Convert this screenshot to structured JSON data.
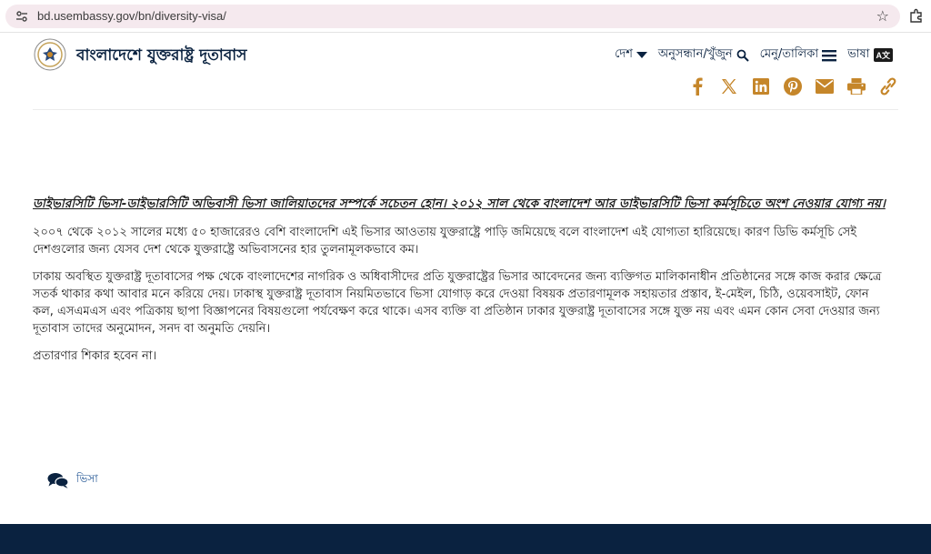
{
  "browser": {
    "url": "bd.usembassy.gov/bn/diversity-visa/"
  },
  "header": {
    "title": "বাংলাদেশে যুক্তরাষ্ট্র দূতাবাস",
    "nav": {
      "country": "দেশ",
      "search": "অনুসন্ধান/খুঁজুন",
      "menu": "মেনু/তালিকা",
      "language": "ভাষা",
      "language_badge": "A文"
    },
    "share_icons": [
      "facebook-icon",
      "x-icon",
      "linkedin-icon",
      "pinterest-icon",
      "email-icon",
      "print-icon",
      "link-icon"
    ],
    "accent_color": "#c5862a",
    "navy_color": "#0a2240"
  },
  "article": {
    "headline": "ডাইভারসিটি ভিসা-ডাইভারসিটি অভিবাসী ভিসা জালিয়াতদের সম্পর্কে সচেতন হোন। ২০১২ সাল থেকে বাংলাদেশ আর ডাইভারসিটি ভিসা কর্মসূচিতে অংশ নেওয়ার যোগ্য নয়।",
    "para1": "২০০৭ থেকে ২০১২ সালের মধ্যে ৫০ হাজারেরও বেশি বাংলাদেশি এই ভিসার আওতায় যুক্তরাষ্ট্রে পাড়ি জমিয়েছে বলে বাংলাদেশ এই যোগ্যতা হারিয়েছে। কারণ ডিভি কর্মসূচি সেই দেশগুলোর জন্য যেসব দেশ থেকে যুক্তরাষ্ট্রে অভিবাসনের হার তুলনামূলকভাবে কম।",
    "para2": "ঢাকায় অবস্থিত যুক্তরাষ্ট্র দূতাবাসের পক্ষ থেকে বাংলাদেশের নাগরিক ও অধিবাসীদের প্রতি যুক্তরাষ্ট্রের ভিসার আবেদনের জন্য ব্যক্তিগত মালিকানাধীন প্রতিষ্ঠানের সঙ্গে কাজ করার ক্ষেত্রে সতর্ক থাকার কথা আবার মনে করিয়ে দেয়। ঢাকাস্থ যুক্তরাষ্ট্র দূতাবাস নিয়মিতভাবে ভিসা যোগাড় করে দেওয়া বিষয়ক প্রতারণামূলক সহায়তার প্রস্তাব, ই-মেইল, চিঠি, ওয়েবসাইট, ফোন কল, এসএমএস এবং পত্রিকায় ছাপা বিজ্ঞাপনের বিষয়গুলো পর্যবেক্ষণ করে থাকে। এসব ব্যক্তি বা প্রতিষ্ঠান ঢাকার যুক্তরাষ্ট্র দূতাবাসের সঙ্গে যুক্ত নয় এবং এমন কোন সেবা দেওয়ার জন্য দূতাবাস তাদের অনুমোদন, সনদ বা অনুমতি দেয়নি।",
    "para3": "প্রতারণার শিকার হবেন না।"
  },
  "tags": {
    "label": "ভিসা"
  }
}
